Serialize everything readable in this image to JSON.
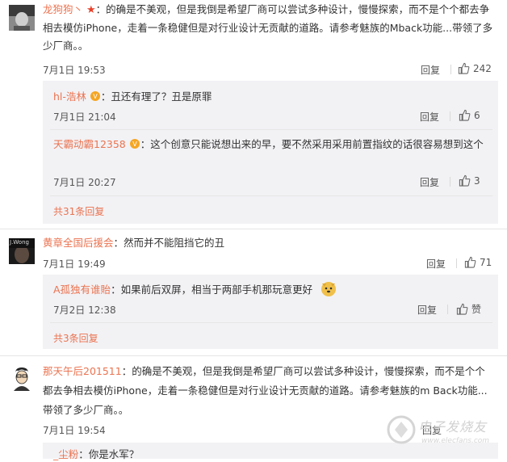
{
  "comments": [
    {
      "user": "龙狗狗丶",
      "text": "：的确是不美观，但是我倒是希望厂商可以尝试多种设计，慢慢探索，而不是个个都去争相去模仿iPhone，走着一条稳健但是对行业设计无贡献的道路。请参考魅族的Mback功能...带领了多少厂商。。",
      "date": "7月1日 19:53",
      "reply": "回复",
      "likes": "242",
      "replies": [
        {
          "user": "hl-浩林",
          "text": "：丑还有理了？丑是原罪",
          "date": "7月1日 21:04",
          "reply": "回复",
          "likes": "6"
        },
        {
          "user": "天霸动霸12358",
          "text": "：这个创意只能说想出来的早，要不然采用采用前置指纹的话很容易想到这个",
          "date": "7月1日 20:27",
          "reply": "回复",
          "likes": "3"
        }
      ],
      "more": "共31条回复"
    },
    {
      "user": "黄章全国后援会",
      "text": "：然而并不能阻挡它的丑",
      "avatar_text": "J.Wong",
      "date": "7月1日 19:49",
      "reply": "回复",
      "likes": "71",
      "replies": [
        {
          "user": "A孤独有谁貽",
          "text": "：如果前后双屏，相当于两部手机那玩意更好",
          "date": "7月2日 12:38",
          "reply": "回复",
          "likes": "赞"
        }
      ],
      "more": "共3条回复"
    },
    {
      "user": "那天午后201511",
      "text": "：的确是不美观，但是我倒是希望厂商可以尝试多种设计，慢慢探索，而不是个个都去争相去模仿iPhone，走着一条稳健但是对行业设计无贡献的道路。请参考魅族的m Back功能...带领了多少厂商。。",
      "date": "7月1日 19:54",
      "reply": "回复",
      "replies": [
        {
          "user": "_尘粉",
          "text": "：你是水军？"
        }
      ]
    }
  ],
  "watermark": "电子发烧友",
  "watermark_url": "www.elecfans.com",
  "colors": {
    "username": "#eb7350",
    "subbox_bg": "#f2f2f5",
    "text": "#333333"
  }
}
